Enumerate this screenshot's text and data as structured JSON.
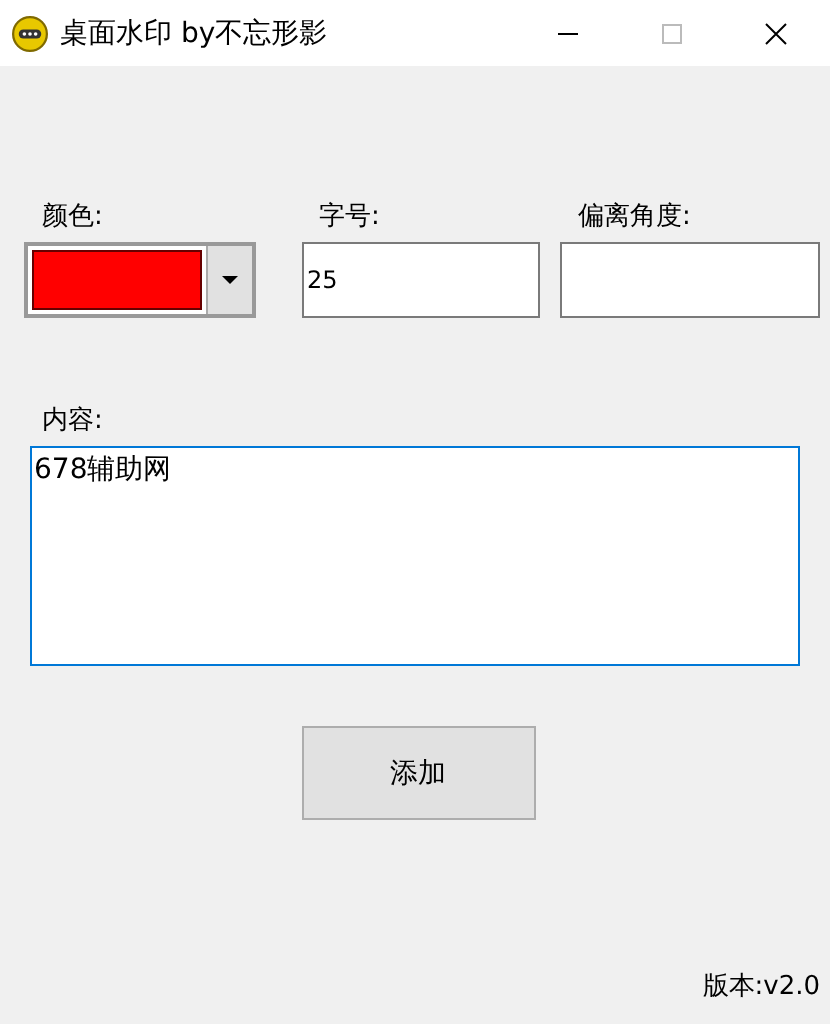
{
  "window": {
    "title": "桌面水印  by不忘形影"
  },
  "fields": {
    "color": {
      "label": "颜色:",
      "color": "#ff0000"
    },
    "size": {
      "label": "字号:",
      "value": "25"
    },
    "angle": {
      "label": "偏离角度:"
    }
  },
  "content": {
    "label": "内容:",
    "value": "678辅助网"
  },
  "add_button": "添加",
  "version": "版本:v2.0"
}
